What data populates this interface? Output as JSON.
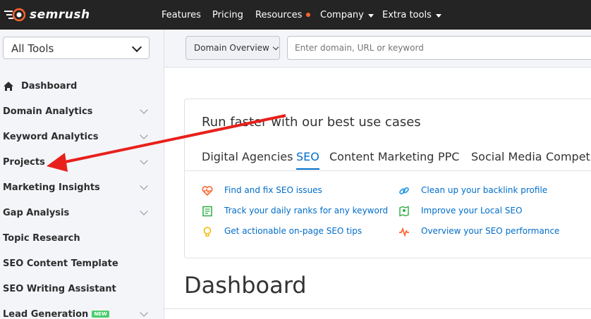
{
  "header": {
    "brand": "semrush",
    "nav": [
      {
        "label": "Features"
      },
      {
        "label": "Pricing"
      },
      {
        "label": "Resources"
      },
      {
        "label": "Company"
      },
      {
        "label": "Extra tools"
      }
    ]
  },
  "sidebar": {
    "tools_select": "All Tools",
    "items": [
      {
        "label": "Dashboard"
      },
      {
        "label": "Domain Analytics"
      },
      {
        "label": "Keyword Analytics"
      },
      {
        "label": "Projects"
      },
      {
        "label": "Marketing Insights"
      },
      {
        "label": "Gap Analysis"
      },
      {
        "label": "Topic Research"
      },
      {
        "label": "SEO Content Template"
      },
      {
        "label": "SEO Writing Assistant"
      },
      {
        "label": "Lead Generation",
        "badge": "NEW"
      }
    ]
  },
  "search": {
    "select": "Domain Overview",
    "placeholder": "Enter domain, URL or keyword"
  },
  "usecases": {
    "title": "Run faster with our best use cases",
    "tabs": [
      "Digital Agencies",
      "SEO",
      "Content Marketing",
      "PPC",
      "Social Media",
      "Competi"
    ],
    "active_tab": "SEO",
    "items": [
      {
        "label": "Find and fix SEO issues",
        "icon": "heart-pulse-icon"
      },
      {
        "label": "Clean up your backlink profile",
        "icon": "link-icon"
      },
      {
        "label": "Track your daily ranks for any keyword",
        "icon": "document-icon"
      },
      {
        "label": "Improve your Local SEO",
        "icon": "map-pin-icon"
      },
      {
        "label": "Get actionable on-page SEO tips",
        "icon": "lightbulb-icon"
      },
      {
        "label": "Overview your SEO performance",
        "icon": "pulse-icon"
      }
    ]
  },
  "page_title": "Dashboard",
  "colors": {
    "topbar": "#242424",
    "accent": "#006dca",
    "orange": "#ff642d",
    "arrow": "#e8201c"
  }
}
